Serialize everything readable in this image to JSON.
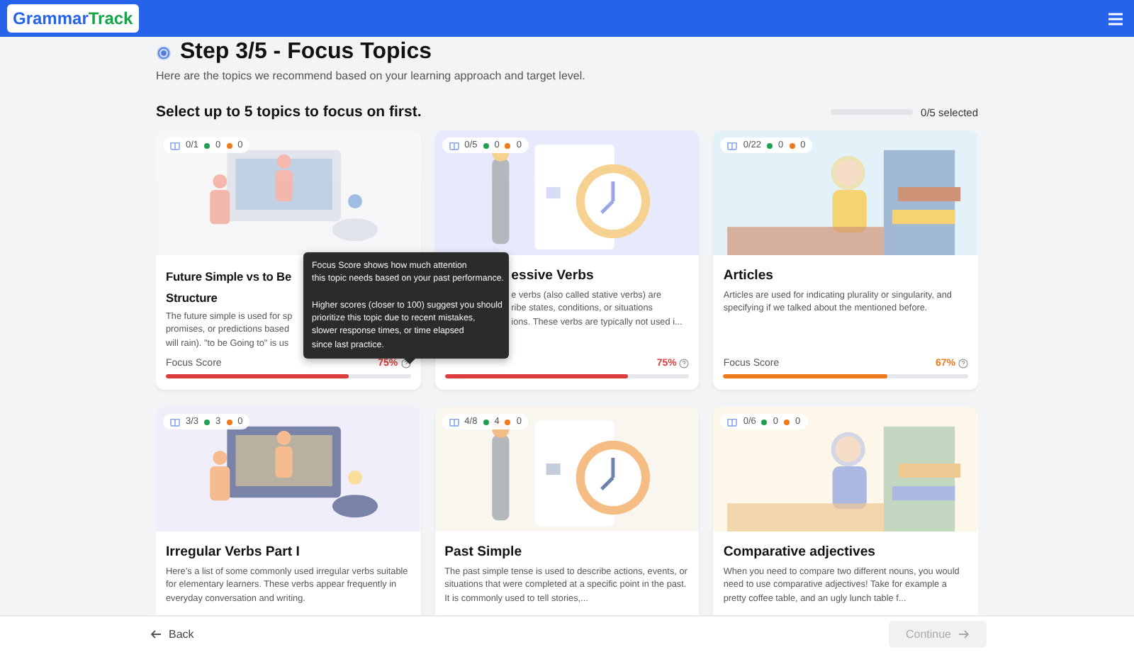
{
  "header": {
    "logo": [
      "Grammar",
      "Track"
    ]
  },
  "intro": {
    "title": "Step 3/5 - Focus Topics",
    "subtitle": "Here are the topics we recommend based on your learning approach and target level.",
    "prompt": "Select up to 5 topics to focus on first.",
    "selection": {
      "level": 0,
      "text": "0/5 selected"
    }
  },
  "cards": [
    {
      "kind": "cut_right",
      "stats": {
        "progress": "0/1",
        "correct": "0",
        "wrong": "0"
      },
      "title_lines": [
        "Future Simple vs to Be",
        "Structure"
      ],
      "description_lines": [
        "The future simple is used for sp",
        "promises, or predictions based",
        "will rain). \"to be Going to\" is us"
      ],
      "focus": {
        "label": "Focus Score",
        "value": "75%",
        "level": 0.75,
        "color": "#dc3c3c"
      }
    },
    {
      "kind": "cut_left",
      "stats": {
        "progress": "0/5",
        "correct": "0",
        "wrong": "0"
      },
      "title_lines": [
        "essive Verbs"
      ],
      "description_lines": [
        "e verbs (also called stative verbs) are",
        "ribe states, conditions, or situations",
        "ions. These verbs are typically not used i..."
      ],
      "focus": {
        "value": "75%",
        "level": 0.75,
        "color": "#dc3c3c"
      }
    },
    {
      "kind": "full",
      "stats": {
        "progress": "0/22",
        "correct": "0",
        "wrong": "0"
      },
      "title": "Articles",
      "description": "Articles are used for indicating plurality or singularity, and specifying if we talked about the mentioned before.",
      "focus": {
        "label": "Focus Score",
        "value": "67%",
        "level": 0.67,
        "color": "#f07a1a"
      }
    },
    {
      "kind": "full",
      "stats": {
        "progress": "3/3",
        "correct": "3",
        "wrong": "0"
      },
      "title": "Irregular Verbs Part I",
      "description": "Here’s a list of some commonly used irregular verbs suitable for elementary learners. These verbs appear frequently in everyday conversation and writing."
    },
    {
      "kind": "full",
      "stats": {
        "progress": "4/8",
        "correct": "4",
        "wrong": "0"
      },
      "title": "Past Simple",
      "description": "The past simple tense is used to describe actions, events, or situations that were completed at a specific point in the past. It is commonly used to tell stories,..."
    },
    {
      "kind": "full",
      "stats": {
        "progress": "0/6",
        "correct": "0",
        "wrong": "0"
      },
      "title": "Comparative adjectives",
      "description": "When you need to compare two different nouns, you would need to use comparative adjectives! Take for example a pretty coffee table, and an ugly lunch table f..."
    }
  ],
  "tooltip": {
    "paragraphs": [
      [
        "Focus Score shows how much attention",
        "this topic needs based on your past performance."
      ],
      [
        "Higher scores (closer to 100) suggest you should",
        "prioritize this topic due to recent mistakes,",
        "slower response times, or time elapsed",
        "since last practice."
      ]
    ]
  },
  "footer": {
    "back": "Back",
    "continue": {
      "label": "Continue",
      "disabled": true
    }
  }
}
